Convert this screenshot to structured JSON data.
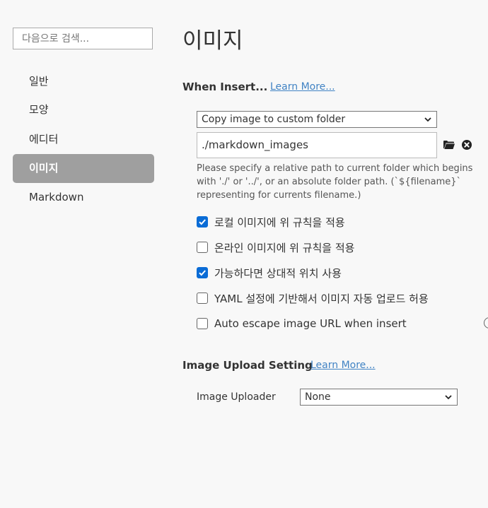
{
  "sidebar": {
    "search_placeholder": "다음으로 검색...",
    "items": [
      {
        "label": "일반"
      },
      {
        "label": "모양"
      },
      {
        "label": "에디터"
      },
      {
        "label": "이미지",
        "active": true
      },
      {
        "label": "Markdown"
      }
    ]
  },
  "main": {
    "title": "이미지",
    "when_insert": {
      "heading": "When Insert...",
      "learn_more": "Learn More...",
      "action_select": "Copy image to custom folder",
      "path_value": "./markdown_images",
      "help_text": " Please specify a relative path to current folder which begins with './' or '../', or an absolute folder path. (`${filename}` representing for currents filename.)",
      "options": [
        {
          "label": "로컬 이미지에 위 규칙을 적용",
          "checked": true
        },
        {
          "label": "온라인 이미지에 위 규칙을 적용",
          "checked": false
        },
        {
          "label": "가능하다면 상대적 위치 사용",
          "checked": true
        },
        {
          "label": "YAML 설정에 기반해서 이미지 자동 업로드 허용",
          "checked": false
        },
        {
          "label": "Auto escape image URL when insert",
          "checked": false
        }
      ]
    },
    "upload": {
      "heading": "Image Upload Setting",
      "learn_more": "Learn More...",
      "uploader_label": "Image Uploader",
      "uploader_value": "None"
    }
  },
  "icons": {
    "folder": "folder-icon",
    "clear": "close-circle-icon",
    "chevron": "chevron-down-icon"
  },
  "colors": {
    "accent": "#0a6cd6",
    "link": "#4183c4",
    "active_nav": "#9f9f9f",
    "background": "#f8f8f8"
  }
}
